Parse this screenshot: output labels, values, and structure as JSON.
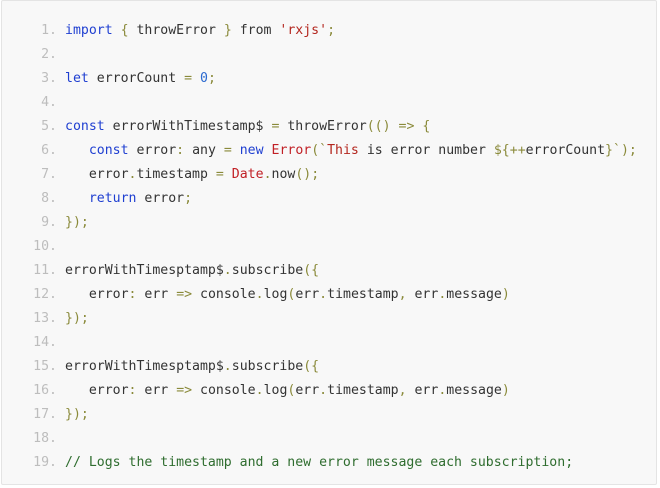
{
  "code": {
    "lines": [
      {
        "n": "1.",
        "tokens": [
          {
            "t": "import",
            "c": "kw"
          },
          {
            "t": " ",
            "c": "var"
          },
          {
            "t": "{",
            "c": "punct"
          },
          {
            "t": " throwError ",
            "c": "var"
          },
          {
            "t": "}",
            "c": "punct"
          },
          {
            "t": " from ",
            "c": "var"
          },
          {
            "t": "'rxjs'",
            "c": "str"
          },
          {
            "t": ";",
            "c": "punct"
          }
        ]
      },
      {
        "n": "2.",
        "tokens": []
      },
      {
        "n": "3.",
        "tokens": [
          {
            "t": "let",
            "c": "kw"
          },
          {
            "t": " errorCount ",
            "c": "var"
          },
          {
            "t": "=",
            "c": "punct"
          },
          {
            "t": " ",
            "c": "var"
          },
          {
            "t": "0",
            "c": "num"
          },
          {
            "t": ";",
            "c": "punct"
          }
        ]
      },
      {
        "n": "4.",
        "tokens": []
      },
      {
        "n": "5.",
        "tokens": [
          {
            "t": "const",
            "c": "kw"
          },
          {
            "t": " errorWithTimestamp$ ",
            "c": "var"
          },
          {
            "t": "=",
            "c": "punct"
          },
          {
            "t": " throwError",
            "c": "fn"
          },
          {
            "t": "(()",
            "c": "punct"
          },
          {
            "t": " ",
            "c": "var"
          },
          {
            "t": "=>",
            "c": "punct"
          },
          {
            "t": " ",
            "c": "var"
          },
          {
            "t": "{",
            "c": "punct"
          }
        ]
      },
      {
        "n": "6.",
        "tokens": [
          {
            "t": "   ",
            "c": "var"
          },
          {
            "t": "const",
            "c": "kw"
          },
          {
            "t": " error",
            "c": "var"
          },
          {
            "t": ":",
            "c": "punct"
          },
          {
            "t": " any ",
            "c": "type"
          },
          {
            "t": "=",
            "c": "punct"
          },
          {
            "t": " ",
            "c": "var"
          },
          {
            "t": "new",
            "c": "kw"
          },
          {
            "t": " ",
            "c": "var"
          },
          {
            "t": "Error",
            "c": "class"
          },
          {
            "t": "(`",
            "c": "punct"
          },
          {
            "t": "This",
            "c": "str"
          },
          {
            "t": " is error number ",
            "c": "template"
          },
          {
            "t": "${",
            "c": "punct"
          },
          {
            "t": "++",
            "c": "punct"
          },
          {
            "t": "errorCount",
            "c": "var"
          },
          {
            "t": "}`",
            "c": "punct"
          },
          {
            "t": ");",
            "c": "punct"
          }
        ]
      },
      {
        "n": "7.",
        "tokens": [
          {
            "t": "   error",
            "c": "var"
          },
          {
            "t": ".",
            "c": "punct"
          },
          {
            "t": "timestamp ",
            "c": "var"
          },
          {
            "t": "=",
            "c": "punct"
          },
          {
            "t": " ",
            "c": "var"
          },
          {
            "t": "Date",
            "c": "class"
          },
          {
            "t": ".",
            "c": "punct"
          },
          {
            "t": "now",
            "c": "fn"
          },
          {
            "t": "();",
            "c": "punct"
          }
        ]
      },
      {
        "n": "8.",
        "tokens": [
          {
            "t": "   ",
            "c": "var"
          },
          {
            "t": "return",
            "c": "kw"
          },
          {
            "t": " error",
            "c": "var"
          },
          {
            "t": ";",
            "c": "punct"
          }
        ]
      },
      {
        "n": "9.",
        "tokens": [
          {
            "t": "});",
            "c": "punct"
          }
        ]
      },
      {
        "n": "10.",
        "tokens": []
      },
      {
        "n": "11.",
        "tokens": [
          {
            "t": "errorWithTimesptamp$",
            "c": "var"
          },
          {
            "t": ".",
            "c": "punct"
          },
          {
            "t": "subscribe",
            "c": "fn"
          },
          {
            "t": "({",
            "c": "punct"
          }
        ]
      },
      {
        "n": "12.",
        "tokens": [
          {
            "t": "   error",
            "c": "var"
          },
          {
            "t": ":",
            "c": "punct"
          },
          {
            "t": " err ",
            "c": "var"
          },
          {
            "t": "=>",
            "c": "punct"
          },
          {
            "t": " console",
            "c": "var"
          },
          {
            "t": ".",
            "c": "punct"
          },
          {
            "t": "log",
            "c": "fn"
          },
          {
            "t": "(",
            "c": "punct"
          },
          {
            "t": "err",
            "c": "var"
          },
          {
            "t": ".",
            "c": "punct"
          },
          {
            "t": "timestamp",
            "c": "var"
          },
          {
            "t": ",",
            "c": "punct"
          },
          {
            "t": " err",
            "c": "var"
          },
          {
            "t": ".",
            "c": "punct"
          },
          {
            "t": "message",
            "c": "var"
          },
          {
            "t": ")",
            "c": "punct"
          }
        ]
      },
      {
        "n": "13.",
        "tokens": [
          {
            "t": "});",
            "c": "punct"
          }
        ]
      },
      {
        "n": "14.",
        "tokens": []
      },
      {
        "n": "15.",
        "tokens": [
          {
            "t": "errorWithTimesptamp$",
            "c": "var"
          },
          {
            "t": ".",
            "c": "punct"
          },
          {
            "t": "subscribe",
            "c": "fn"
          },
          {
            "t": "({",
            "c": "punct"
          }
        ]
      },
      {
        "n": "16.",
        "tokens": [
          {
            "t": "   error",
            "c": "var"
          },
          {
            "t": ":",
            "c": "punct"
          },
          {
            "t": " err ",
            "c": "var"
          },
          {
            "t": "=>",
            "c": "punct"
          },
          {
            "t": " console",
            "c": "var"
          },
          {
            "t": ".",
            "c": "punct"
          },
          {
            "t": "log",
            "c": "fn"
          },
          {
            "t": "(",
            "c": "punct"
          },
          {
            "t": "err",
            "c": "var"
          },
          {
            "t": ".",
            "c": "punct"
          },
          {
            "t": "timestamp",
            "c": "var"
          },
          {
            "t": ",",
            "c": "punct"
          },
          {
            "t": " err",
            "c": "var"
          },
          {
            "t": ".",
            "c": "punct"
          },
          {
            "t": "message",
            "c": "var"
          },
          {
            "t": ")",
            "c": "punct"
          }
        ]
      },
      {
        "n": "17.",
        "tokens": [
          {
            "t": "});",
            "c": "punct"
          }
        ]
      },
      {
        "n": "18.",
        "tokens": []
      },
      {
        "n": "19.",
        "tokens": [
          {
            "t": "// Logs the timestamp and a new error message each subscription;",
            "c": "comment"
          }
        ]
      }
    ]
  },
  "colors": {
    "background": "#f8f8f8",
    "keyword": "#1f3fd1",
    "string": "#b3261e",
    "number": "#2b69cf",
    "comment": "#2f6d2f",
    "line_number": "#bdbdbd"
  }
}
